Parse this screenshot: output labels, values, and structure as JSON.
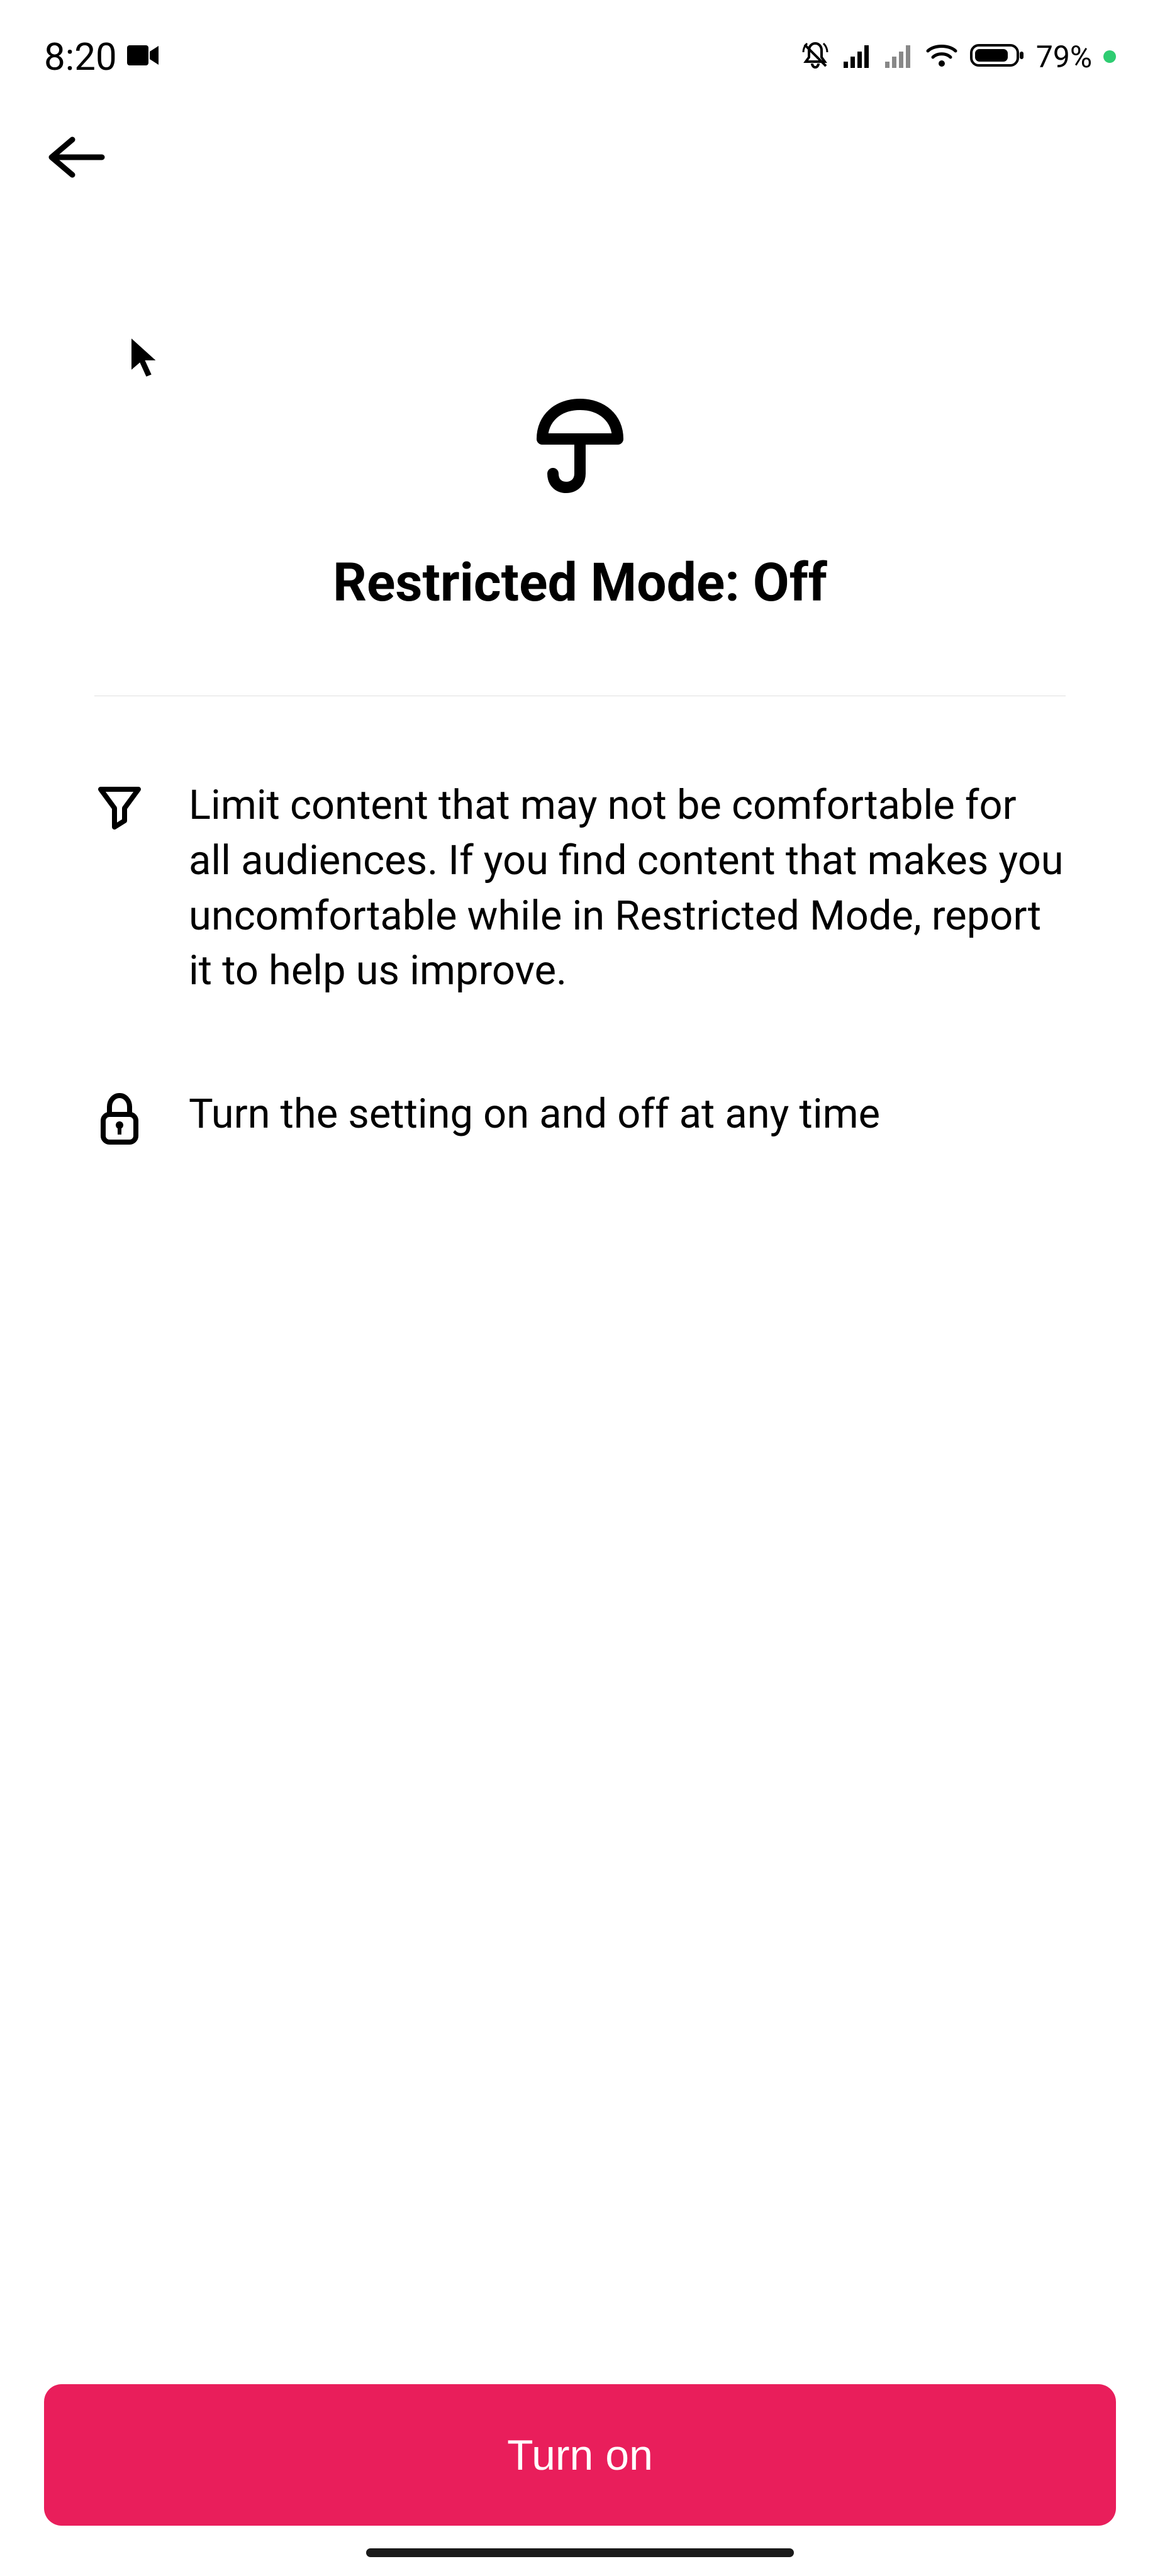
{
  "status": {
    "time": "8:20",
    "battery_percent": "79%"
  },
  "page": {
    "title": "Restricted Mode: Off"
  },
  "info": [
    {
      "text": "Limit content that may not be comfortable for all audiences. If you find content that makes you uncomfortable while in Restricted Mode, report it to help us improve."
    },
    {
      "text": "Turn the setting on and off at any time"
    }
  ],
  "button": {
    "primary_label": "Turn on"
  }
}
